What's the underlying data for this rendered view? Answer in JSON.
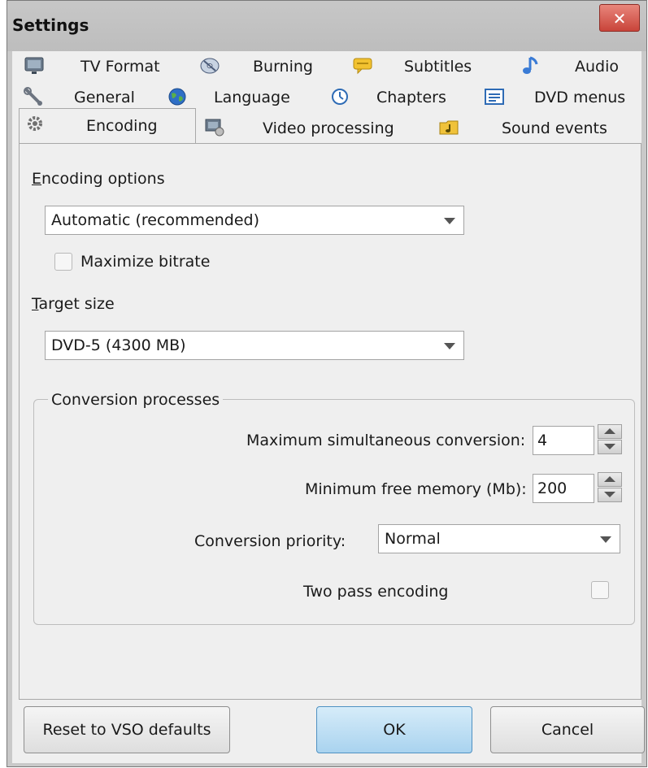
{
  "window": {
    "title": "Settings",
    "close_glyph": "✕"
  },
  "tabs": [
    {
      "label": "TV Format",
      "icon": "tv-monitor-icon"
    },
    {
      "label": "Burning",
      "icon": "disc-icon"
    },
    {
      "label": "Subtitles",
      "icon": "speech-bubble-icon"
    },
    {
      "label": "Audio",
      "icon": "music-note-icon"
    },
    {
      "label": "General",
      "icon": "wrench-icon"
    },
    {
      "label": "Language",
      "icon": "globe-icon"
    },
    {
      "label": "Chapters",
      "icon": "clock-icon"
    },
    {
      "label": "DVD menus",
      "icon": "menu-list-icon"
    },
    {
      "label": "Encoding",
      "icon": "gear-icon",
      "active": true
    },
    {
      "label": "Video processing",
      "icon": "video-settings-icon"
    },
    {
      "label": "Sound events",
      "icon": "music-folder-icon"
    }
  ],
  "encoding": {
    "options_label_first": "E",
    "options_label_rest": "ncoding options",
    "options_value": "Automatic (recommended)",
    "maximize_bitrate_label": "Maximize bitrate",
    "maximize_bitrate_checked": false,
    "target_size_label_first": "T",
    "target_size_label_rest": "arget size",
    "target_size_value": "DVD-5 (4300 MB)"
  },
  "conversion": {
    "group_title": "Conversion processes",
    "max_simultaneous_label": "Maximum simultaneous conversion:",
    "max_simultaneous_value": "4",
    "min_free_memory_label": "Minimum free memory (Mb):",
    "min_free_memory_value": "200",
    "priority_label": "Conversion priority:",
    "priority_value": "Normal",
    "two_pass_label": "Two pass encoding",
    "two_pass_checked": false
  },
  "buttons": {
    "reset": "Reset to VSO defaults",
    "ok": "OK",
    "cancel": "Cancel"
  },
  "colors": {
    "close_button": "#c9443a",
    "ok_button": "#a9d3ef"
  }
}
